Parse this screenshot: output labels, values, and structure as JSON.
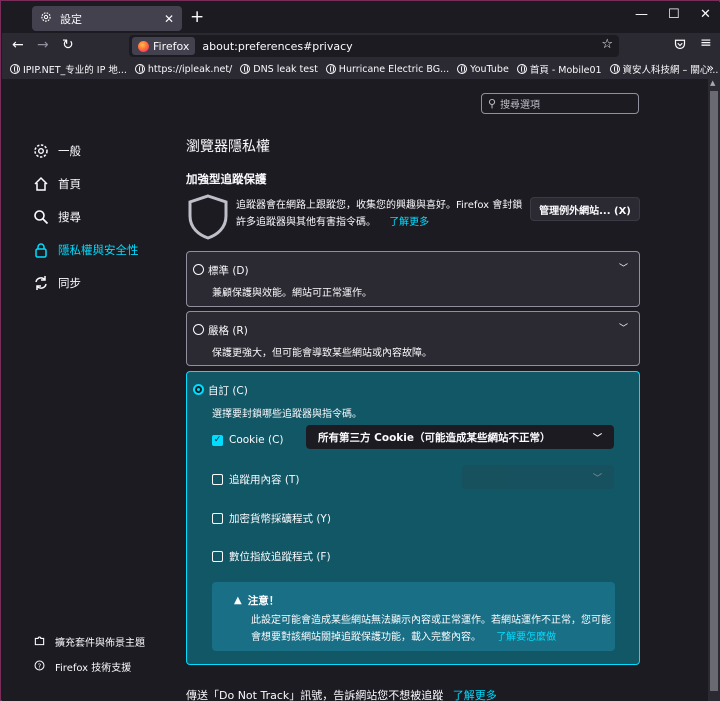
{
  "window": {
    "tab_title": "設定",
    "tab_icon": "gear-icon",
    "controls": {
      "minimize": "—",
      "maximize": "☐",
      "close": "✕"
    }
  },
  "navbar": {
    "back": "←",
    "forward": "→",
    "reload": "↻",
    "identity_label": "Firefox",
    "url": "about:preferences#privacy",
    "star": "☆"
  },
  "bookmarks": [
    {
      "label": "IPIP.NET_专业的 IP 地..."
    },
    {
      "label": "https://ipleak.net/"
    },
    {
      "label": "DNS leak test"
    },
    {
      "label": "Hurricane Electric BG..."
    },
    {
      "label": "YouTube"
    },
    {
      "label": "首頁 - Mobile01"
    },
    {
      "label": "資安人科技網 – 關心..."
    }
  ],
  "search": {
    "placeholder": "搜尋選項"
  },
  "sidebar": {
    "items": [
      {
        "label": "一般",
        "icon": "gear-icon",
        "active": false
      },
      {
        "label": "首頁",
        "icon": "home-icon",
        "active": false
      },
      {
        "label": "搜尋",
        "icon": "search-icon",
        "active": false
      },
      {
        "label": "隱私權與安全性",
        "icon": "lock-icon",
        "active": true
      },
      {
        "label": "同步",
        "icon": "sync-icon",
        "active": false
      }
    ],
    "footer": [
      {
        "label": "擴充套件與佈景主題",
        "icon": "puzzle-icon"
      },
      {
        "label": "Firefox 技術支援",
        "icon": "help-icon"
      }
    ]
  },
  "main": {
    "title": "瀏覽器隱私權",
    "section_title": "加強型追蹤保護",
    "etp_description": "追蹤器會在網路上跟蹤您，收集您的興趣與喜好。Firefox 會封鎖許多追蹤器與其他有害指令碼。",
    "learn_more": "了解更多",
    "exceptions_button": "管理例外網站... (X)",
    "standard": {
      "label": "標準 (D)",
      "desc": "兼顧保護與效能。網站可正常運作。"
    },
    "strict": {
      "label": "嚴格 (R)",
      "desc": "保護更強大，但可能會導致某些網站或內容故障。"
    },
    "custom": {
      "label": "自訂 (C)",
      "desc": "選擇要封鎖哪些追蹤器與指令碼。",
      "cookie_label": "Cookie (C)",
      "cookie_select": "所有第三方 Cookie（可能造成某些網站不正常）",
      "tracking_label": "追蹤用內容 (T)",
      "crypto_label": "加密貨幣採礦程式 (Y)",
      "fingerprint_label": "數位指紋追蹤程式 (F)",
      "warning_title": "注意！",
      "warning_text": "此設定可能會造成某些網站無法顯示內容或正常運作。若網站運作不正常，您可能會想要對該網站關掉追蹤保護功能，載入完整內容。",
      "warning_link": "了解要怎麼做"
    },
    "dnt_text": "傳送「Do Not Track」訊號，告訴網站您不想被追蹤",
    "dnt_link": "了解更多"
  },
  "colors": {
    "accent": "#00ddff",
    "background": "#1c1b22",
    "card": "#2b2a33",
    "selected_card": "#115766"
  }
}
